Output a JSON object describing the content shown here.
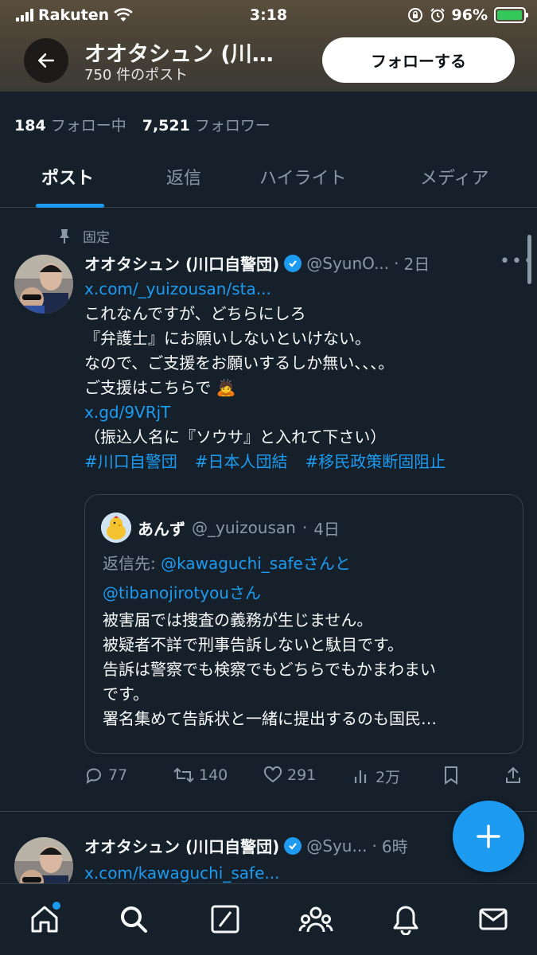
{
  "status_bar": {
    "carrier": "Rakuten",
    "time": "3:18",
    "battery": "96%",
    "battery_level": 0.96
  },
  "header": {
    "display_name": "オオタシュン (川…",
    "post_count": "750 件のポスト",
    "follow_label": "フォローする"
  },
  "stats": {
    "following_count": "184",
    "following_label": "フォロー中",
    "followers_count": "7,521",
    "followers_label": "フォロワー"
  },
  "tabs": [
    {
      "label": "ポスト"
    },
    {
      "label": "返信"
    },
    {
      "label": "ハイライト"
    },
    {
      "label": "メディア"
    }
  ],
  "pinned_label": "固定",
  "tweet1": {
    "name": "オオタシュン (川口自警団)",
    "handle": "@SyunO...",
    "dot": "·",
    "time": "2日",
    "link1": "x.com/_yuizousan/sta...",
    "line1": "これなんですが、どちらにしろ",
    "line2": "『弁護士』にお願いしないといけない。",
    "line3": "なので、ご支援をお願いするしか無い、、、。",
    "line4": "ご支援はこちらで",
    "line4_emoji": "🙇",
    "link2": "x.gd/9VRjT",
    "line5": "（振込人名に『ソウサ』と入れて下さい）",
    "hashtags": [
      "#川口自警団",
      "#日本人団結",
      "#移民政策断固阻止"
    ],
    "quote": {
      "name": "あんず",
      "handle": "@_yuizousan",
      "dot": "·",
      "time": "4日",
      "reply_prefix": "返信先:",
      "reply_user1": "@kawaguchi_safe",
      "reply_and": "さんと",
      "reply_user2": "@tibanojirotyou",
      "reply_san": "さん",
      "lines": [
        "被害届では捜査の義務が生じません。",
        "被疑者不詳で刑事告訴しないと駄目です。",
        "告訴は警察でも検察でもどちらでもかまわまい",
        "です。",
        "署名集めて告訴状と一緒に提出するのも国民…"
      ]
    },
    "actions": {
      "replies": "77",
      "reposts": "140",
      "likes": "291",
      "views": "2万"
    }
  },
  "tweet2": {
    "name": "オオタシュン (川口自警団)",
    "handle": "@Syu...",
    "dot": "·",
    "time": "6時",
    "link1": "x.com/kawaguchi_safe..."
  },
  "colors": {
    "background": "#15202b",
    "accent": "#1d9bf0",
    "muted": "#8b98a5",
    "border": "#38444d"
  },
  "icons": [
    "back-arrow-icon",
    "pin-icon",
    "verified-icon",
    "more-icon",
    "reply-icon",
    "repost-icon",
    "like-icon",
    "views-icon",
    "bookmark-icon",
    "share-icon",
    "compose-icon",
    "home-icon",
    "search-icon",
    "grok-icon",
    "communities-icon",
    "notifications-icon",
    "messages-icon"
  ]
}
